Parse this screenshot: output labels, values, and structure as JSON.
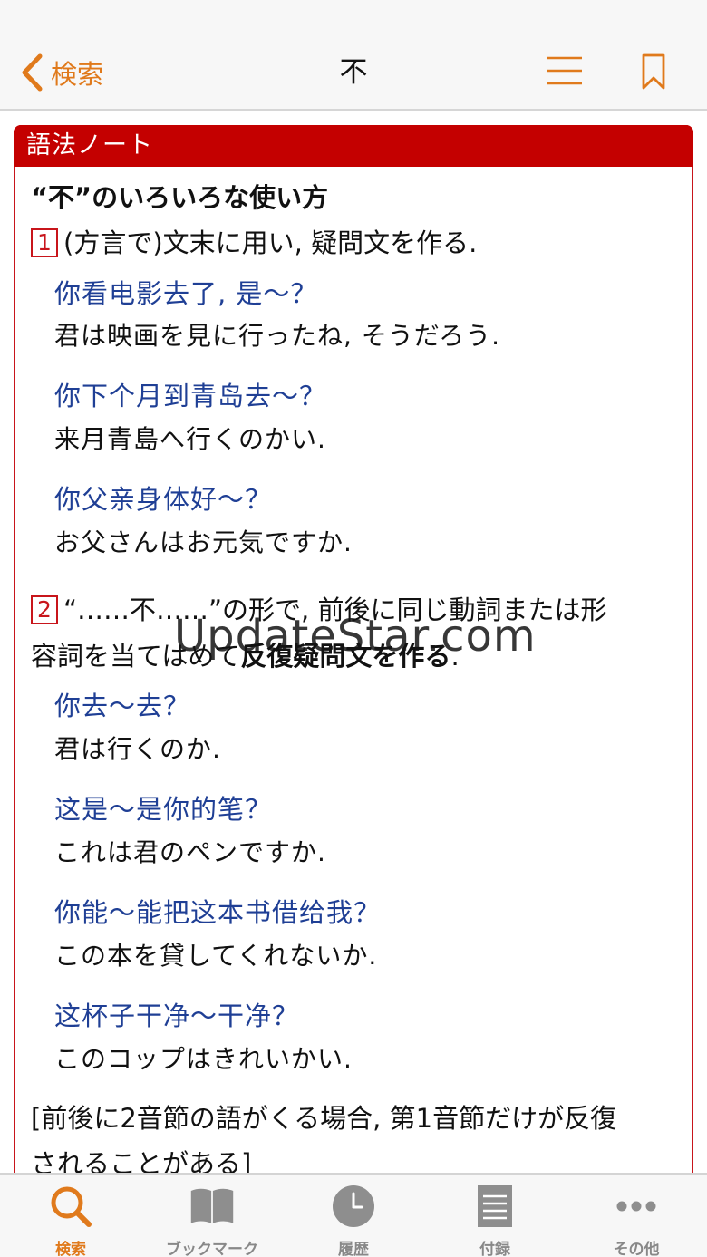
{
  "nav": {
    "back_label": "検索",
    "title": "不"
  },
  "note": {
    "header": "語法ノート",
    "heading": "“不”のいろいろな使い方",
    "sense1": {
      "number": "1",
      "text": "(方言で)文末に用い, 疑問文を作る."
    },
    "examples1": [
      {
        "cn": "你看电影去了, 是〜？",
        "jp": "君は映画を見に行ったね, そうだろう."
      },
      {
        "cn": "你下个月到青岛去〜？",
        "jp": "来月青島へ行くのかい."
      },
      {
        "cn": "你父亲身体好〜？",
        "jp": "お父さんはお元気ですか."
      }
    ],
    "sense2": {
      "number": "2",
      "text_a": "“……不……”の形で, 前後に同じ動詞または形",
      "text_b": "容詞を当てはめて",
      "text_bold": "反復疑問文を作る",
      "text_end": "."
    },
    "examples2": [
      {
        "cn": "你去〜去？",
        "jp": "君は行くのか."
      },
      {
        "cn": "这是〜是你的笔？",
        "jp": "これは君のペンですか."
      },
      {
        "cn": "你能〜能把这本书借给我？",
        "jp": "この本を貸してくれないか."
      },
      {
        "cn": "这杯子干净〜干净？",
        "jp": "このコップはきれいかい."
      }
    ],
    "bracket_note_a": "[前後に2音節の語がくる場合, 第1音節だけが反復",
    "bracket_note_b": "されることがある]"
  },
  "watermark": "UpdateStar.com",
  "tabs": [
    {
      "label": "検索",
      "icon": "search-icon",
      "active": true
    },
    {
      "label": "ブックマーク",
      "icon": "book-icon",
      "active": false
    },
    {
      "label": "履歴",
      "icon": "clock-icon",
      "active": false
    },
    {
      "label": "付録",
      "icon": "document-icon",
      "active": false
    },
    {
      "label": "その他",
      "icon": "more-icon",
      "active": false
    }
  ],
  "colors": {
    "accent": "#e07a1c",
    "note_red": "#c40000",
    "chinese_blue": "#1f3f95"
  }
}
